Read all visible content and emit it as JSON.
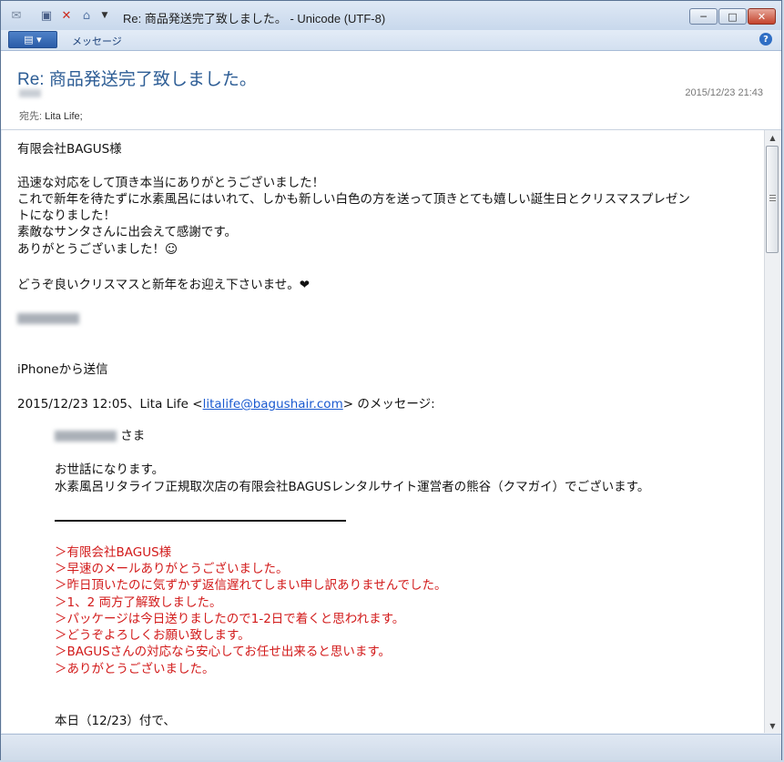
{
  "window": {
    "title": "Re: 商品発送完了致しました。 - Unicode (UTF-8)",
    "minimize_glyph": "─",
    "maximize_glyph": "□",
    "close_glyph": "✕"
  },
  "toolbar": {
    "icons": [
      "envelope-icon",
      "save-icon",
      "delete-icon",
      "move-icon",
      "dropdown-icon"
    ],
    "view_label": "▤ ▾",
    "message_tab": "メッセージ",
    "help_glyph": "?"
  },
  "header": {
    "subject": "Re: 商品発送完了致しました。",
    "date": "2015/12/23 21:43",
    "to_label": "宛先: ",
    "to_value": "Lita Life;"
  },
  "body": {
    "greeting": "有限会社BAGUS様",
    "line1": "迅速な対応をして頂き本当にありがとうございました！",
    "line2": "これで新年を待たずに水素風呂にはいれて、しかも新しい白色の方を送って頂きとても嬉しい誕生日とクリスマスプレゼン",
    "line3": "トになりました！",
    "line4": "素敵なサンタさんに出会えて感謝です。",
    "line5": "ありがとうございました！☺",
    "line6": "どうぞ良いクリスマスと新年をお迎え下さいませ。❤",
    "sent_from": "iPhoneから送信",
    "quote_intro_pre": "2015/12/23 12:05、Lita Life <",
    "quote_email": "litalife@bagushair.com",
    "quote_intro_post": "> のメッセージ:",
    "sama": " さま",
    "q1": "お世話になります。",
    "q2": "水素風呂リタライフ正規取次店の有限会社BAGUSレンタルサイト運営者の熊谷（クマガイ）でございます。",
    "red_lines": [
      "＞有限会社BAGUS様",
      "＞早速のメールありがとうございました。",
      "＞昨日頂いたのに気ずかず返信遅れてしまい申し訳ありませんでした。",
      "＞1、2 両方了解致しました。",
      "＞パッケージは今日送りましたので1-2日で着くと思われます。",
      "＞どうぞよろしくお願い致します。",
      "＞BAGUSさんの対応なら安心してお任せ出来ると思います。",
      "＞ありがとうございました。"
    ],
    "last_line": "本日（12/23）付で、"
  },
  "colors": {
    "subject": "#2d5d95",
    "quote_red": "#d21a1a",
    "link": "#1a5ad0"
  }
}
